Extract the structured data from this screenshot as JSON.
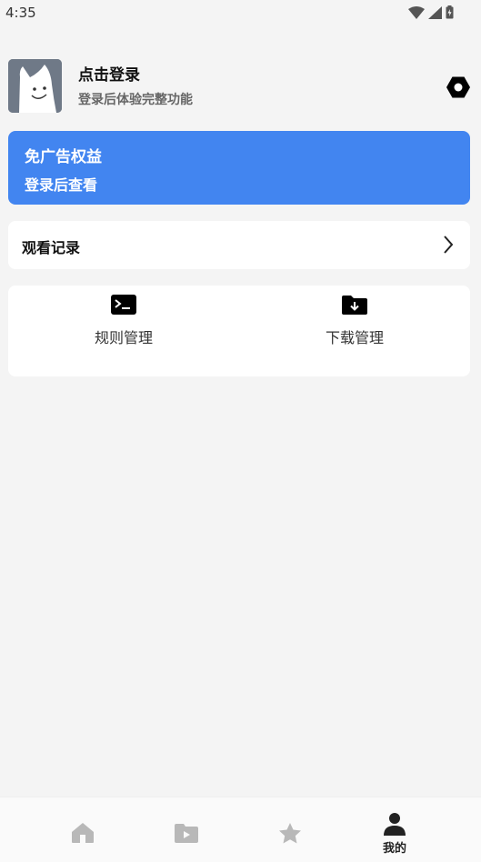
{
  "status_bar": {
    "time": "4:35"
  },
  "profile": {
    "title": "点击登录",
    "subtitle": "登录后体验完整功能"
  },
  "vip_card": {
    "title": "免广告权益",
    "subtitle": "登录后查看",
    "color": "#4285f0"
  },
  "history": {
    "label": "观看记录"
  },
  "tools": [
    {
      "label": "规则管理",
      "icon": "terminal-icon"
    },
    {
      "label": "下载管理",
      "icon": "folder-download-icon"
    }
  ],
  "bottom_nav": {
    "items": [
      {
        "icon": "home-icon",
        "label": ""
      },
      {
        "icon": "video-icon",
        "label": ""
      },
      {
        "icon": "star-icon",
        "label": ""
      },
      {
        "icon": "person-icon",
        "label": "我的",
        "active": true
      }
    ]
  }
}
